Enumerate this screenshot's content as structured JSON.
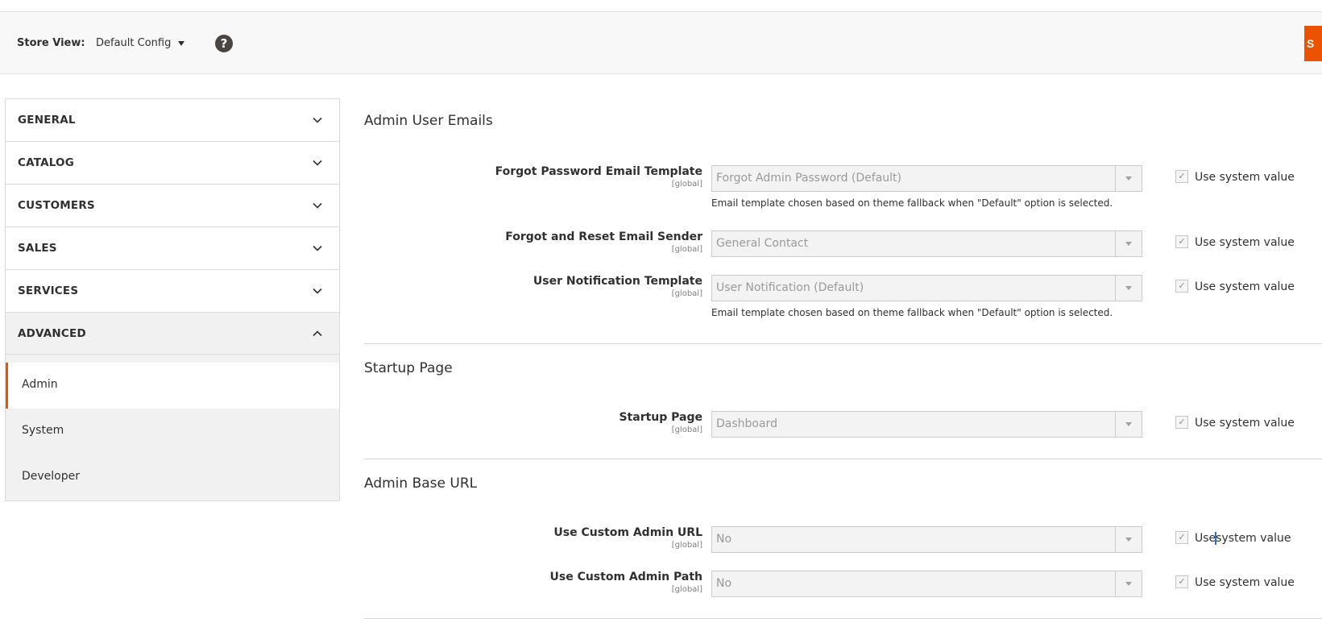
{
  "store_view": {
    "label": "Store View:",
    "selected": "Default Config",
    "save_label": "S"
  },
  "sidebar": {
    "sections": [
      {
        "label": "GENERAL",
        "expanded": false
      },
      {
        "label": "CATALOG",
        "expanded": false
      },
      {
        "label": "CUSTOMERS",
        "expanded": false
      },
      {
        "label": "SALES",
        "expanded": false
      },
      {
        "label": "SERVICES",
        "expanded": false
      },
      {
        "label": "ADVANCED",
        "expanded": true
      }
    ],
    "items": [
      {
        "label": "Admin",
        "active": true
      },
      {
        "label": "System",
        "active": false
      },
      {
        "label": "Developer",
        "active": false
      }
    ]
  },
  "groups": {
    "admin_user_emails": {
      "title": "Admin User Emails",
      "fields": [
        {
          "label": "Forgot Password Email Template",
          "scope": "[global]",
          "value": "Forgot Admin Password (Default)",
          "note": "Email template chosen based on theme fallback when \"Default\" option is selected.",
          "use_system": "Use system value"
        },
        {
          "label": "Forgot and Reset Email Sender",
          "scope": "[global]",
          "value": "General Contact",
          "use_system": "Use system value"
        },
        {
          "label": "User Notification Template",
          "scope": "[global]",
          "value": "User Notification (Default)",
          "note": "Email template chosen based on theme fallback when \"Default\" option is selected.",
          "use_system": "Use system value"
        }
      ]
    },
    "startup_page": {
      "title": "Startup Page",
      "fields": [
        {
          "label": "Startup Page",
          "scope": "[global]",
          "value": "Dashboard",
          "use_system": "Use system value"
        }
      ]
    },
    "admin_base_url": {
      "title": "Admin Base URL",
      "fields": [
        {
          "label": "Use Custom Admin URL",
          "scope": "[global]",
          "value": "No",
          "use_system_a": "Use",
          "use_system_b": "system value"
        },
        {
          "label": "Use Custom Admin Path",
          "scope": "[global]",
          "value": "No",
          "use_system": "Use system value"
        }
      ]
    }
  },
  "colors": {
    "accent": "#eb5202",
    "caret": "#2f6fd1"
  },
  "icons": {
    "help": "question-circle-icon",
    "section_toggle": "chevron-icon",
    "dropdown": "caret-down-icon",
    "checkbox": "check-icon"
  }
}
